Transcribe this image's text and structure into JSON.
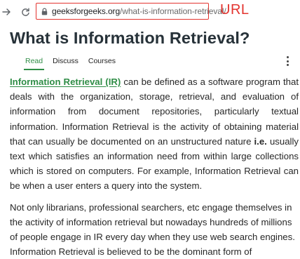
{
  "browser": {
    "forward_icon": "arrow-right-icon",
    "reload_icon": "reload-icon",
    "lock_icon": "lock-icon",
    "url_domain": "geeksforgeeks.org",
    "url_path": "/what-is-information-retrieval/",
    "annotation_label": "URL",
    "annotation_color": "#e3342f"
  },
  "article": {
    "title": "What is Information Retrieval?",
    "tabs": [
      {
        "label": "Read",
        "active": true
      },
      {
        "label": "Discuss",
        "active": false
      },
      {
        "label": "Courses",
        "active": false
      }
    ],
    "more_icon": "more-vertical-icon",
    "accent_color": "#2f8d46",
    "paragraph1": {
      "link_text": "Information Retrieval (IR)",
      "text_a": " can be defined as a software program that deals with the organization, storage, retrieval, and evaluation of information from document repositories, particularly textual information. Information Retrieval is the activity of obtaining material that can usually be documented on an unstructured nature ",
      "bold_text": "i.e.",
      "text_b": " usually text which satisfies an information need from within large collections which is stored on computers. For example, Information Retrieval can be when a user enters a query into the system."
    },
    "paragraph2": {
      "text": "Not only librarians, professional searchers, etc engage themselves in the activity of information retrieval but nowadays hundreds of millions of people engage in IR every day when they use web search engines. Information Retrieval is believed to be the dominant form of"
    }
  }
}
